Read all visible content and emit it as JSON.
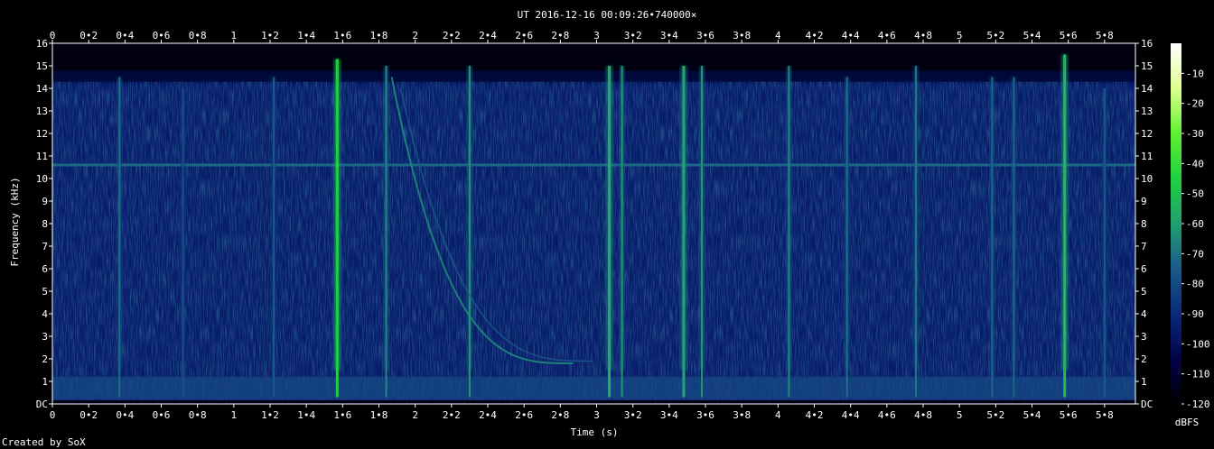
{
  "chart_data": {
    "type": "heatmap",
    "title": "UT 2016-12-16 00:09:26•740000×",
    "xlabel": "Time (s)",
    "ylabel": "Frequency (kHz)",
    "xlim": [
      0,
      5.97
    ],
    "ylim": [
      0,
      16
    ],
    "x_ticks": [
      "0",
      "0•2",
      "0•4",
      "0•6",
      "0•8",
      "1",
      "1•2",
      "1•4",
      "1•6",
      "1•8",
      "2",
      "2•2",
      "2•4",
      "2•6",
      "2•8",
      "3",
      "3•2",
      "3•4",
      "3•6",
      "3•8",
      "4",
      "4•2",
      "4•4",
      "4•6",
      "4•8",
      "5",
      "5•2",
      "5•4",
      "5•6",
      "5•8"
    ],
    "y_ticks": [
      "DC",
      "1",
      "2",
      "3",
      "4",
      "5",
      "6",
      "7",
      "8",
      "9",
      "10",
      "11",
      "12",
      "13",
      "14",
      "15",
      "16"
    ],
    "colorbar": {
      "label": "dBFS",
      "ticks": [
        "-10",
        "-20",
        "-30",
        "-40",
        "-50",
        "-60",
        "-70",
        "-80",
        "-90",
        "-100",
        "-110",
        "-120"
      ],
      "range": [
        -120,
        0
      ],
      "colors": [
        "#000000",
        "#02024a",
        "#0a2a7a",
        "#1a5a8a",
        "#20a070",
        "#20d040",
        "#60f030",
        "#e0ff90",
        "#ffffff"
      ]
    },
    "credit": "Created by SoX",
    "background_level_dbfs": -95,
    "noise_ceiling_khz": 14.3,
    "horizontal_tone": {
      "freq_khz": 10.6,
      "level_dbfs": -72
    },
    "low_band": {
      "freq_from_khz": 0.2,
      "freq_to_khz": 1.2,
      "level_dbfs": -80
    },
    "broadband_events": [
      {
        "time_s": 0.37,
        "level_dbfs": -70,
        "top_khz": 14.5
      },
      {
        "time_s": 0.72,
        "level_dbfs": -78,
        "top_khz": 14
      },
      {
        "time_s": 1.22,
        "level_dbfs": -75,
        "top_khz": 14.5
      },
      {
        "time_s": 1.57,
        "level_dbfs": -45,
        "top_khz": 15.3
      },
      {
        "time_s": 1.84,
        "level_dbfs": -65,
        "top_khz": 15
      },
      {
        "time_s": 2.3,
        "level_dbfs": -62,
        "top_khz": 15
      },
      {
        "time_s": 3.07,
        "level_dbfs": -55,
        "top_khz": 15
      },
      {
        "time_s": 3.14,
        "level_dbfs": -62,
        "top_khz": 15
      },
      {
        "time_s": 3.48,
        "level_dbfs": -58,
        "top_khz": 15
      },
      {
        "time_s": 3.58,
        "level_dbfs": -62,
        "top_khz": 15
      },
      {
        "time_s": 4.06,
        "level_dbfs": -65,
        "top_khz": 15
      },
      {
        "time_s": 4.38,
        "level_dbfs": -70,
        "top_khz": 14.5
      },
      {
        "time_s": 4.76,
        "level_dbfs": -68,
        "top_khz": 15
      },
      {
        "time_s": 5.18,
        "level_dbfs": -72,
        "top_khz": 14.5
      },
      {
        "time_s": 5.3,
        "level_dbfs": -72,
        "top_khz": 14.5
      },
      {
        "time_s": 5.58,
        "level_dbfs": -52,
        "top_khz": 15.5
      },
      {
        "time_s": 5.8,
        "level_dbfs": -75,
        "top_khz": 14
      }
    ],
    "whistler_tones": [
      {
        "start_time_s": 1.87,
        "end_time_s": 2.87,
        "start_khz": 14.5,
        "end_khz": 1.8,
        "level_dbfs": -65
      },
      {
        "start_time_s": 1.92,
        "end_time_s": 2.98,
        "start_khz": 14.0,
        "end_khz": 1.9,
        "level_dbfs": -75
      }
    ]
  }
}
